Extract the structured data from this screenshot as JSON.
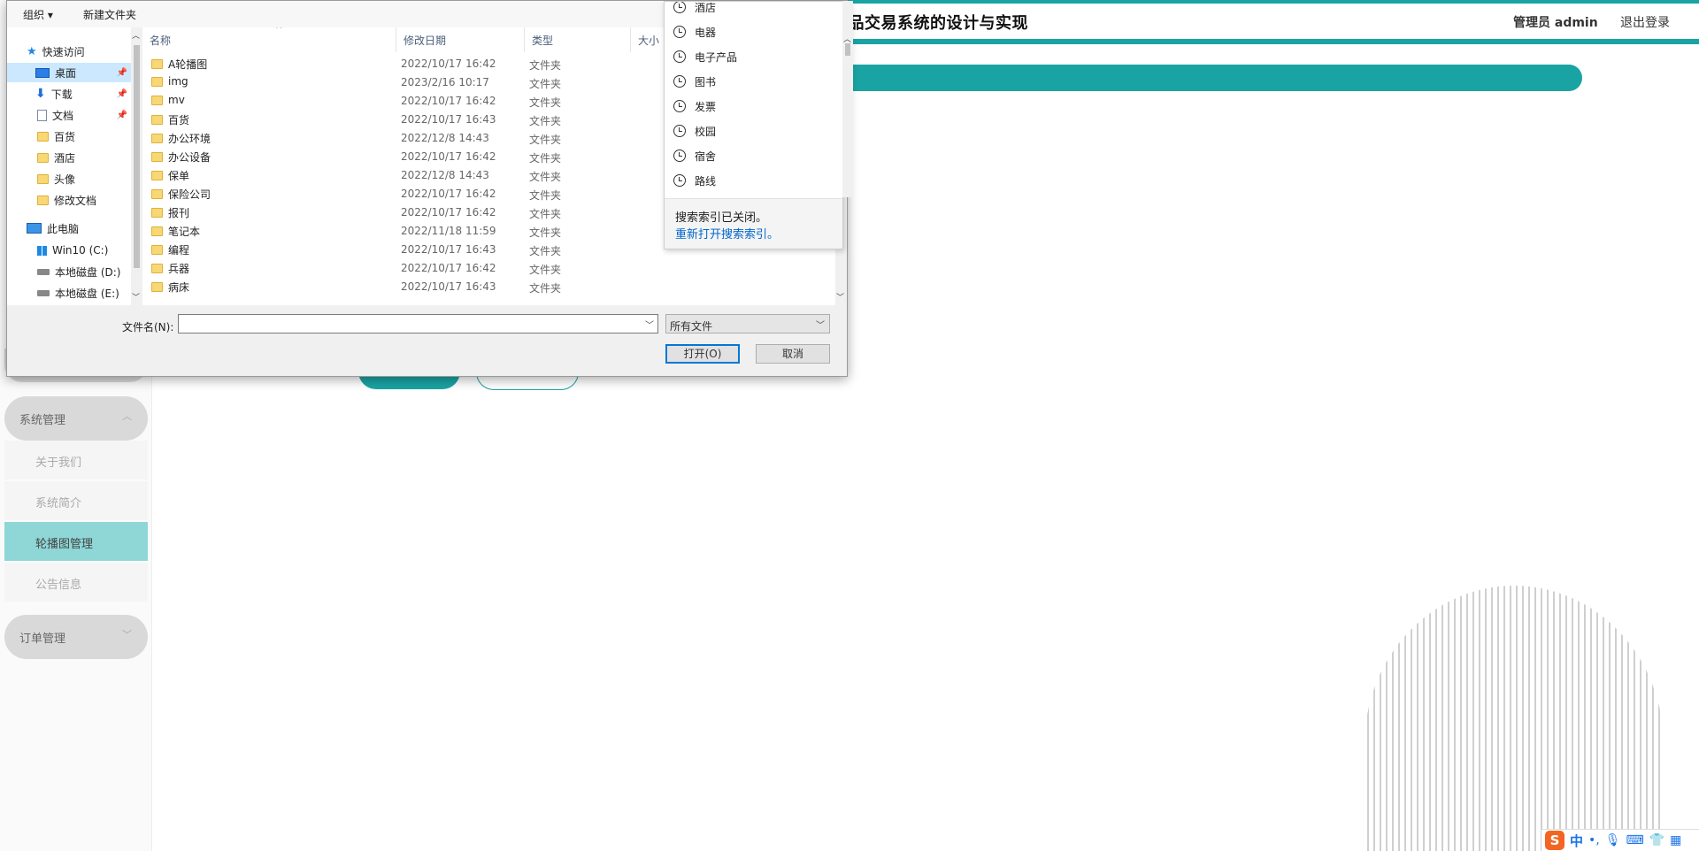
{
  "app": {
    "title": "商品交易系统的设计与实现",
    "admin_label": "管理员 admin",
    "logout": "退出登录",
    "accent": "#1aa3a3"
  },
  "sidebar": {
    "groups": [
      {
        "label": "系统管理",
        "chevron": "chevron-up-icon"
      },
      {
        "label": "订单管理",
        "chevron": "chevron-down-icon"
      }
    ],
    "items": [
      {
        "label": "关于我们"
      },
      {
        "label": "系统简介"
      },
      {
        "label": "轮播图管理",
        "active": true
      },
      {
        "label": "公告信息"
      }
    ]
  },
  "dialog": {
    "toolbar": {
      "organize": "组织 ▾",
      "new_folder": "新建文件夹"
    },
    "nav": [
      {
        "label": "快速访问",
        "icon": "star-icon"
      },
      {
        "label": "桌面",
        "icon": "desktop-icon",
        "selected": true,
        "pinned": true
      },
      {
        "label": "下载",
        "icon": "download-icon",
        "pinned": true
      },
      {
        "label": "文档",
        "icon": "document-icon",
        "pinned": true
      },
      {
        "label": "百货",
        "icon": "folder-icon"
      },
      {
        "label": "酒店",
        "icon": "folder-icon"
      },
      {
        "label": "头像",
        "icon": "folder-icon"
      },
      {
        "label": "修改文档",
        "icon": "folder-icon"
      },
      {
        "label": "此电脑",
        "icon": "pc-icon"
      },
      {
        "label": "Win10 (C:)",
        "icon": "windows-drive-icon"
      },
      {
        "label": "本地磁盘 (D:)",
        "icon": "disk-icon"
      },
      {
        "label": "本地磁盘 (E:)",
        "icon": "disk-icon"
      }
    ],
    "columns": {
      "name": "名称",
      "date": "修改日期",
      "type": "类型",
      "size": "大小"
    },
    "files": [
      {
        "name": "A轮播图",
        "date": "2022/10/17 16:42",
        "type": "文件夹"
      },
      {
        "name": "img",
        "date": "2023/2/16 10:17",
        "type": "文件夹"
      },
      {
        "name": "mv",
        "date": "2022/10/17 16:42",
        "type": "文件夹"
      },
      {
        "name": "百货",
        "date": "2022/10/17 16:43",
        "type": "文件夹"
      },
      {
        "name": "办公环境",
        "date": "2022/12/8 14:43",
        "type": "文件夹"
      },
      {
        "name": "办公设备",
        "date": "2022/10/17 16:42",
        "type": "文件夹"
      },
      {
        "name": "保单",
        "date": "2022/12/8 14:43",
        "type": "文件夹"
      },
      {
        "name": "保险公司",
        "date": "2022/10/17 16:42",
        "type": "文件夹"
      },
      {
        "name": "报刊",
        "date": "2022/10/17 16:42",
        "type": "文件夹"
      },
      {
        "name": "笔记本",
        "date": "2022/11/18 11:59",
        "type": "文件夹"
      },
      {
        "name": "编程",
        "date": "2022/10/17 16:43",
        "type": "文件夹"
      },
      {
        "name": "兵器",
        "date": "2022/10/17 16:42",
        "type": "文件夹"
      },
      {
        "name": "病床",
        "date": "2022/10/17 16:43",
        "type": "文件夹"
      }
    ],
    "filename_label": "文件名(N):",
    "filename_value": "",
    "filetype_value": "所有文件",
    "open_button": "打开(O)",
    "cancel_button": "取消"
  },
  "search_history": {
    "items": [
      "酒店",
      "电器",
      "电子产品",
      "图书",
      "发票",
      "校园",
      "宿舍",
      "路线"
    ],
    "index_message": "搜索索引已关闭。",
    "reopen_link": "重新打开搜索索引。"
  },
  "tray": {
    "ime_logo": "S",
    "ime_mode": "中",
    "punct": "•,",
    "icons": [
      "microphone-icon",
      "keyboard-icon",
      "skin-icon",
      "apps-icon"
    ]
  }
}
